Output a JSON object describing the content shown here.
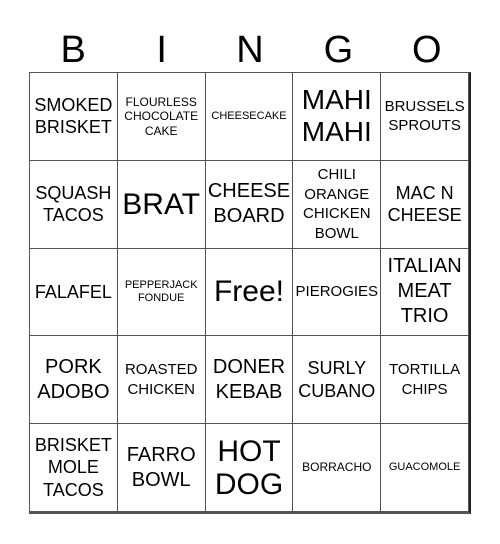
{
  "header": {
    "letters": [
      "B",
      "I",
      "N",
      "G",
      "O"
    ]
  },
  "cells": [
    [
      "SMOKED\nBRISKET",
      "FLOURLESS\nCHOCOLATE\nCAKE",
      "CHEESECAKE",
      "MAHI\nMAHI",
      "BRUSSELS\nSPROUTS"
    ],
    [
      "SQUASH\nTACOS",
      "BRAT",
      "CHEESE\nBOARD",
      "CHILI\nORANGE\nCHICKEN\nBOWL",
      "MAC N\nCHEESE"
    ],
    [
      "FALAFEL",
      "PEPPERJACK\nFONDUE",
      "Free!",
      "PIEROGIES",
      "ITALIAN\nMEAT\nTRIO"
    ],
    [
      "PORK\nADOBO",
      "ROASTED\nCHICKEN",
      "DONER\nKEBAB",
      "SURLY\nCUBANO",
      "TORTILLA\nCHIPS"
    ],
    [
      "BRISKET\nMOLE\nTACOS",
      "FARRO\nBOWL",
      "HOT\nDOG",
      "BORRACHO",
      "GUACOMOLE"
    ]
  ]
}
